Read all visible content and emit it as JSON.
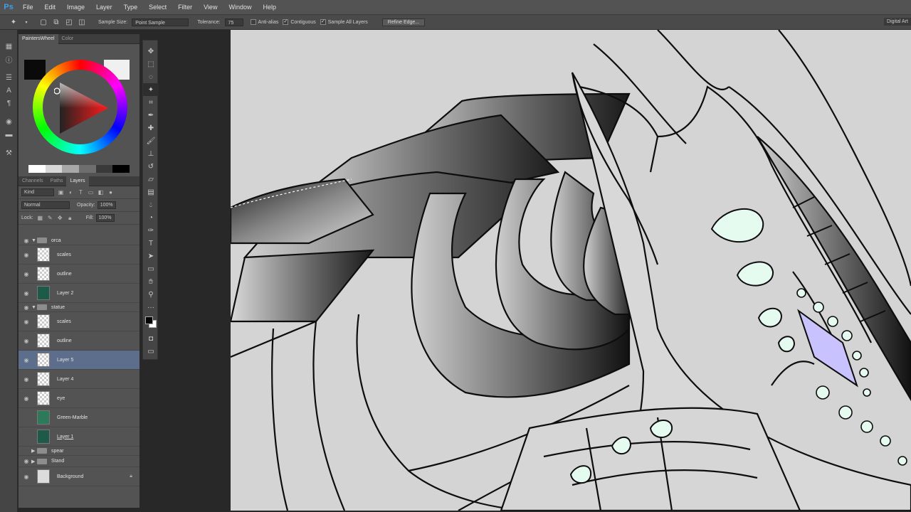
{
  "app": {
    "logo": "Ps"
  },
  "menu": [
    "File",
    "Edit",
    "Image",
    "Layer",
    "Type",
    "Select",
    "Filter",
    "View",
    "Window",
    "Help"
  ],
  "options": {
    "sample_size_label": "Sample Size:",
    "sample_size_value": "Point Sample",
    "tolerance_label": "Tolerance:",
    "tolerance_value": "75",
    "anti_alias": "Anti-alias",
    "contiguous": "Contiguous",
    "sample_all_layers": "Sample All Layers",
    "refine_edge": "Refine Edge...",
    "workspace": "Digital Art"
  },
  "color_panel": {
    "tabs": [
      "PaintersWheel",
      "Color"
    ],
    "active_tab": "PaintersWheel",
    "foreground_color": "#0a0a0a",
    "background_color": "#f0f0f0",
    "grays": [
      "#ffffff",
      "#d8d8d8",
      "#a8a8a8",
      "#6e6e6e",
      "#3a3a3a",
      "#000000"
    ]
  },
  "layers_panel": {
    "tabs": [
      "Channels",
      "Paths",
      "Layers"
    ],
    "active_tab": "Layers",
    "filter": "Kind",
    "blend_mode": "Normal",
    "opacity_label": "Opacity:",
    "opacity_value": "100%",
    "lock_label": "Lock:",
    "fill_label": "Fill:",
    "fill_value": "100%",
    "layers": [
      {
        "name": "orca",
        "kind": "group",
        "expanded": true,
        "visible": true
      },
      {
        "name": "scales",
        "kind": "layer",
        "thumb": "trans",
        "visible": true
      },
      {
        "name": "outline",
        "kind": "layer",
        "thumb": "trans",
        "visible": true
      },
      {
        "name": "Layer 2",
        "kind": "layer",
        "thumb": "art",
        "visible": true
      },
      {
        "name": "statue",
        "kind": "group",
        "expanded": true,
        "visible": true
      },
      {
        "name": "scales",
        "kind": "layer",
        "thumb": "trans",
        "visible": true
      },
      {
        "name": "outline",
        "kind": "layer",
        "thumb": "trans",
        "visible": true
      },
      {
        "name": "Layer 5",
        "kind": "layer",
        "thumb": "trans",
        "visible": true,
        "selected": true
      },
      {
        "name": "Layer 4",
        "kind": "layer",
        "thumb": "trans",
        "visible": true
      },
      {
        "name": "eye",
        "kind": "layer",
        "thumb": "trans",
        "visible": true
      },
      {
        "name": "Green-Marble",
        "kind": "layer",
        "thumb": "marble",
        "visible": false
      },
      {
        "name": "Layer 1",
        "kind": "layer",
        "thumb": "art",
        "visible": false,
        "underline": true
      },
      {
        "name": "spear",
        "kind": "group",
        "expanded": false,
        "visible": false
      },
      {
        "name": "Stand",
        "kind": "group",
        "expanded": false,
        "visible": true
      },
      {
        "name": "Background",
        "kind": "layer",
        "thumb": "plain",
        "visible": true,
        "locked": true
      }
    ]
  }
}
